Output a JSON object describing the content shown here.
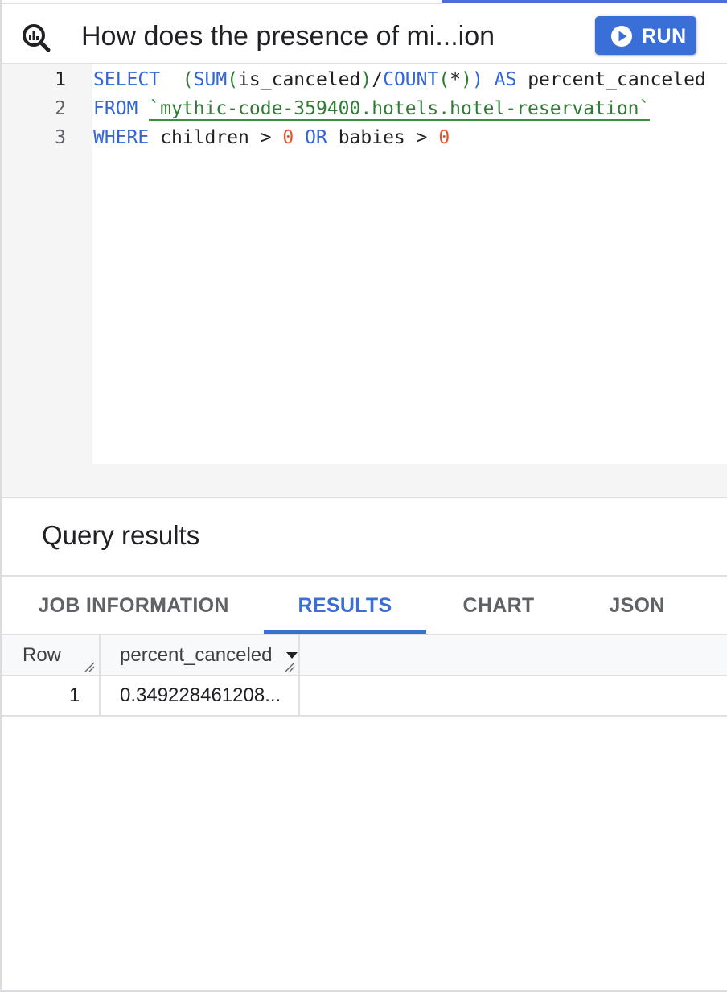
{
  "header": {
    "title": "How does the presence of mi...ion",
    "run_label": "RUN"
  },
  "editor": {
    "lines": [
      {
        "number": "1",
        "tokens": [
          {
            "t": "SELECT",
            "c": "kw"
          },
          {
            "t": "  ",
            "c": "ident"
          },
          {
            "t": "(",
            "c": "par"
          },
          {
            "t": "SUM",
            "c": "kw"
          },
          {
            "t": "(",
            "c": "par"
          },
          {
            "t": "is_canceled",
            "c": "ident"
          },
          {
            "t": ")",
            "c": "par"
          },
          {
            "t": "/",
            "c": "ident"
          },
          {
            "t": "COUNT",
            "c": "kw"
          },
          {
            "t": "(",
            "c": "par"
          },
          {
            "t": "*",
            "c": "ident"
          },
          {
            "t": ")",
            "c": "par"
          },
          {
            "t": ")",
            "c": "kw"
          },
          {
            "t": " ",
            "c": "ident"
          },
          {
            "t": "AS",
            "c": "kw"
          },
          {
            "t": " percent_canceled",
            "c": "ident"
          }
        ]
      },
      {
        "number": "2",
        "tokens": [
          {
            "t": "FROM",
            "c": "kw"
          },
          {
            "t": " ",
            "c": "ident"
          },
          {
            "t": "`mythic-code-359400.hotels.hotel-reservation`",
            "c": "str"
          }
        ]
      },
      {
        "number": "3",
        "tokens": [
          {
            "t": "WHERE",
            "c": "kw"
          },
          {
            "t": " children > ",
            "c": "ident"
          },
          {
            "t": "0",
            "c": "num"
          },
          {
            "t": " ",
            "c": "ident"
          },
          {
            "t": "OR",
            "c": "kw"
          },
          {
            "t": " babies > ",
            "c": "ident"
          },
          {
            "t": "0",
            "c": "num"
          }
        ]
      }
    ]
  },
  "results": {
    "title": "Query results",
    "tabs": [
      {
        "label": "JOB INFORMATION",
        "active": false
      },
      {
        "label": "RESULTS",
        "active": true
      },
      {
        "label": "CHART",
        "active": false
      },
      {
        "label": "JSON",
        "active": false
      }
    ],
    "columns": [
      "Row",
      "percent_canceled"
    ],
    "rows": [
      {
        "row": "1",
        "percent_canceled": "0.349228461208..."
      }
    ]
  },
  "colors": {
    "accent": "#3b6fd8",
    "keyword": "#3367d6",
    "string": "#2e7d32",
    "number": "#e8542f"
  },
  "icons": {
    "query": "bigquery-search-icon",
    "run": "play-circle-icon",
    "sort": "sort-desc-arrow-icon",
    "resize": "column-resize-handle-icon"
  }
}
